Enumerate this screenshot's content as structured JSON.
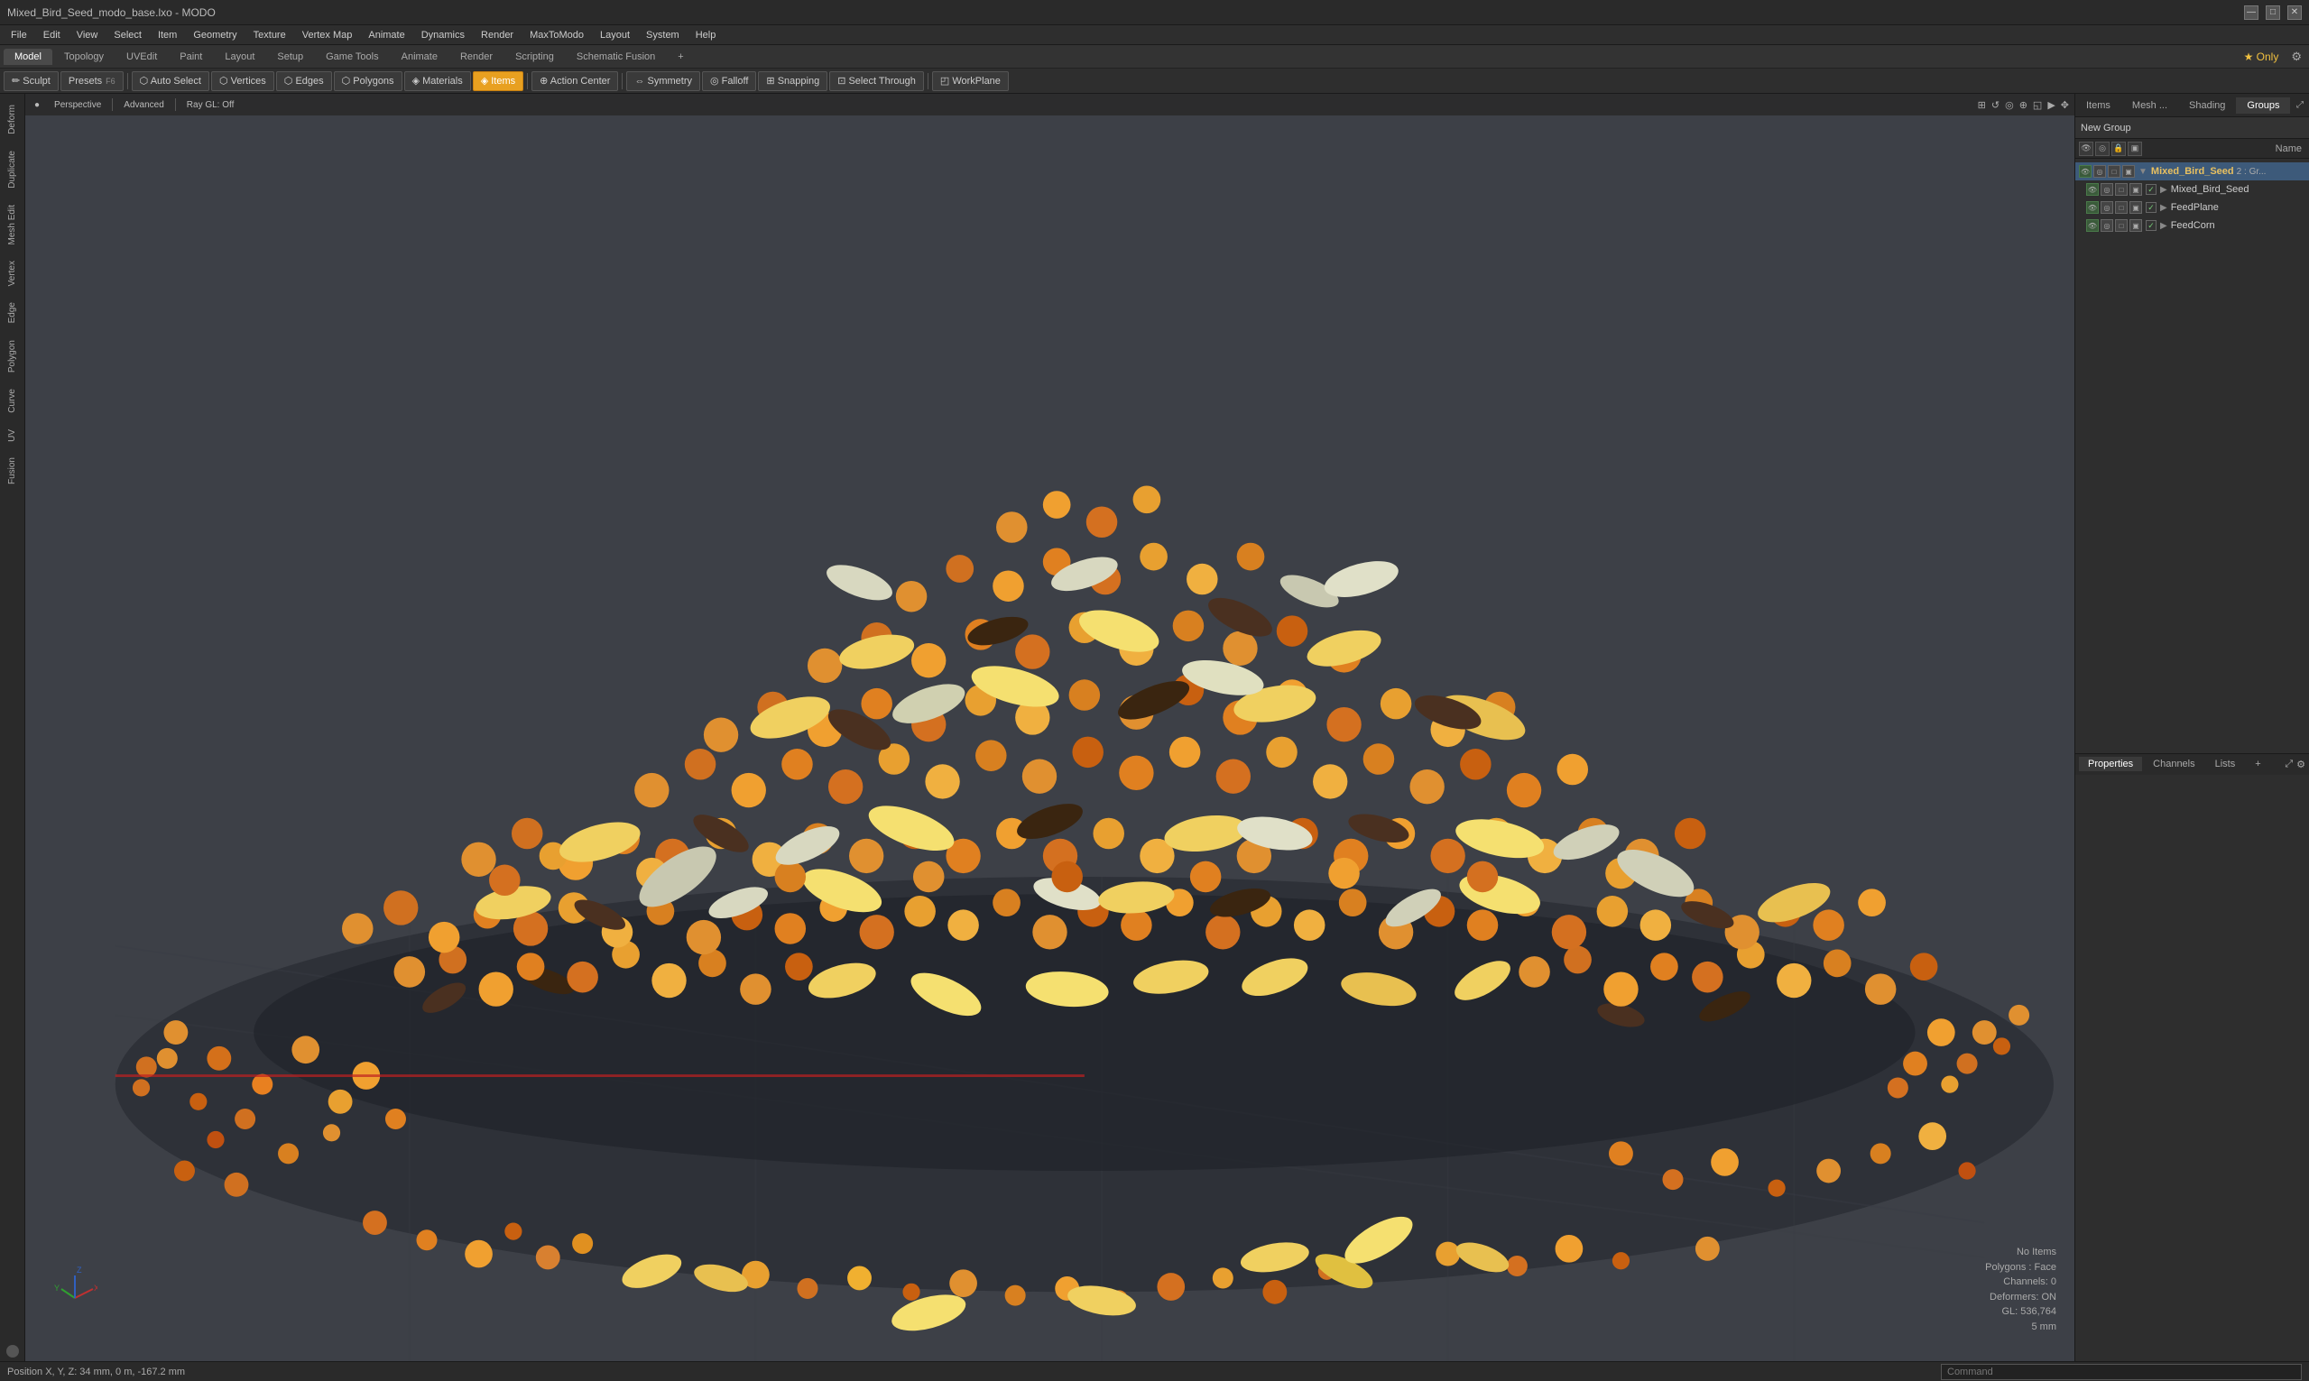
{
  "window": {
    "title": "Mixed_Bird_Seed_modo_base.lxo - MODO"
  },
  "titlebar": {
    "controls": [
      "—",
      "□",
      "✕"
    ]
  },
  "menubar": {
    "items": [
      "File",
      "Edit",
      "View",
      "Select",
      "Item",
      "Geometry",
      "Texture",
      "Vertex Map",
      "Animate",
      "Dynamics",
      "Render",
      "MaxToModo",
      "Layout",
      "System",
      "Help"
    ]
  },
  "tabs": {
    "items": [
      "Model",
      "Topology",
      "UVEdit",
      "Paint",
      "Layout",
      "Setup",
      "Game Tools",
      "Animate",
      "Render",
      "Scripting",
      "Schematic Fusion"
    ],
    "active": "Model",
    "plus": "+",
    "star_label": "Only",
    "gear": "⚙"
  },
  "toolbar": {
    "sculpt": "✏ Sculpt",
    "presets": "Presets",
    "presets_shortcut": "F6",
    "auto_select": "Auto Select",
    "vertices": "Vertices",
    "edges": "Edges",
    "polygons": "Polygons",
    "materials": "Materials",
    "items": "Items",
    "action_center": "Action Center",
    "symmetry": "Symmetry",
    "falloff": "Falloff",
    "snapping": "Snapping",
    "select_through": "Select Through",
    "workplane": "WorkPlane"
  },
  "left_tabs": {
    "items": [
      "Deform",
      "Duplicate",
      "Mesh Edit",
      "Vertex",
      "Edge",
      "Polygon",
      "Curve",
      "UV",
      "Fusion"
    ]
  },
  "viewport": {
    "perspective": "Perspective",
    "advanced": "Advanced",
    "ray_gl": "Ray GL: Off",
    "icons": [
      "⊞",
      "↺",
      "◎",
      "⊕",
      "◱",
      "▶",
      "✥"
    ]
  },
  "status_overlay": {
    "line1": "No Items",
    "line2": "Polygons : Face",
    "line3": "Channels: 0",
    "line4": "Deformers: ON",
    "line5": "GL: 536,764",
    "line6": "5 mm"
  },
  "right_panel": {
    "tabs": [
      "Items",
      "Mesh ...",
      "Shading",
      "Groups"
    ],
    "active_tab": "Groups",
    "new_group": "New Group",
    "expand_icon": "⤢",
    "settings_icon": "⚙"
  },
  "scene_tree": {
    "column_name": "Name",
    "rows": [
      {
        "id": "root",
        "name": "Mixed_Bird_Seed",
        "suffix": "2 : Gr...",
        "type": "group",
        "indent": 0,
        "checked": true
      },
      {
        "id": "mixed_bird_seed_mesh",
        "name": "Mixed_Bird_Seed",
        "type": "mesh",
        "indent": 1,
        "checked": true
      },
      {
        "id": "feed_plane",
        "name": "FeedPlane",
        "type": "mesh",
        "indent": 1,
        "checked": true
      },
      {
        "id": "feed_corn",
        "name": "FeedCorn",
        "type": "mesh",
        "indent": 1,
        "checked": true
      }
    ]
  },
  "bottom_right_panel": {
    "tabs": [
      "Properties",
      "Channels",
      "Lists"
    ],
    "active_tab": "Properties",
    "plus": "+",
    "expand_icon": "⤢",
    "settings_icon": "⚙"
  },
  "bottom_bar": {
    "position": "Position X, Y, Z:  34 mm, 0 m, -167.2 mm",
    "command_placeholder": "Command"
  }
}
